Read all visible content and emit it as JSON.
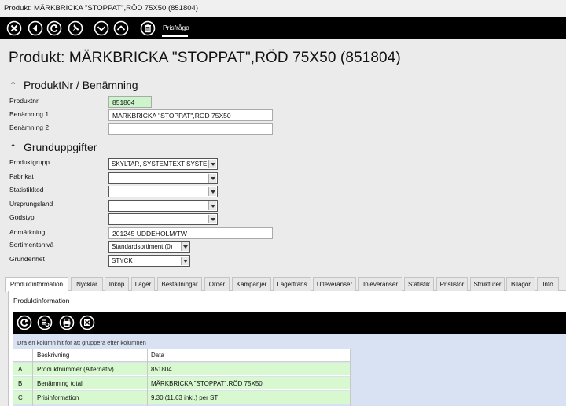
{
  "window": {
    "title": "Produkt: MÄRKBRICKA \"STOPPAT\",RÖD 75X50 (851804)"
  },
  "toolbar": {
    "icons": [
      "close-icon",
      "back-icon",
      "refresh-icon",
      "pin-icon",
      "chevron-down-icon",
      "chevron-up-icon",
      "delete-icon"
    ],
    "tab_label": "Prisfråga"
  },
  "page": {
    "title": "Produkt: MÄRKBRICKA \"STOPPAT\",RÖD 75X50 (851804)"
  },
  "sections": {
    "produktnr": {
      "title": "ProduktNr / Benämning"
    },
    "grunduppgifter": {
      "title": "Grunduppgifter"
    }
  },
  "fields": {
    "produktnr": {
      "label": "Produktnr",
      "value": "851804"
    },
    "benamning1": {
      "label": "Benämning 1",
      "value": "MÄRKBRICKA \"STOPPAT\",RÖD 75X50"
    },
    "benamning2": {
      "label": "Benämning 2",
      "value": ""
    },
    "produktgrupp": {
      "label": "Produktgrupp",
      "value": "SKYLTAR, SYSTEMTEXT SYSTEM"
    },
    "fabrikat": {
      "label": "Fabrikat",
      "value": ""
    },
    "statistikkod": {
      "label": "Statistikkod",
      "value": ""
    },
    "ursprungsland": {
      "label": "Ursprungsland",
      "value": ""
    },
    "godstyp": {
      "label": "Godstyp",
      "value": ""
    },
    "anmarkning": {
      "label": "Anmärkning",
      "value": "201245 UDDEHOLM/TW"
    },
    "sortimentsniva": {
      "label": "Sortimentsnivå",
      "value": "Standardsortiment (0)"
    },
    "grundenhet": {
      "label": "Grundenhet",
      "value": "STYCK"
    }
  },
  "tabs": [
    "Produktinformation",
    "Nycklar",
    "Inköp",
    "Lager",
    "Beställningar",
    "Order",
    "Kampanjer",
    "Lagertrans",
    "Utleveranser",
    "Inleveranser",
    "Statistik",
    "Prislistor",
    "Strukturer",
    "Bilagor",
    "Info"
  ],
  "active_tab": "Produktinformation",
  "panel": {
    "title": "Produktinformation",
    "toolbar_icons": [
      "refresh-icon",
      "settings-list-icon",
      "print-icon",
      "export-icon"
    ],
    "group_hint": "Dra en kolumn hit för att gruppera efter kolumnen",
    "columns": [
      "Beskrivning",
      "Data"
    ],
    "rows": [
      {
        "key": "A",
        "description": "Produktnummer (Alternativ)",
        "data": "851804"
      },
      {
        "key": "B",
        "description": "Benämning total",
        "data": "MÄRKBRICKA \"STOPPAT\",RÖD 75X50"
      },
      {
        "key": "C",
        "description": "Prisinformation",
        "data": "9.30  (11.63 inkl.) per ST"
      }
    ]
  }
}
